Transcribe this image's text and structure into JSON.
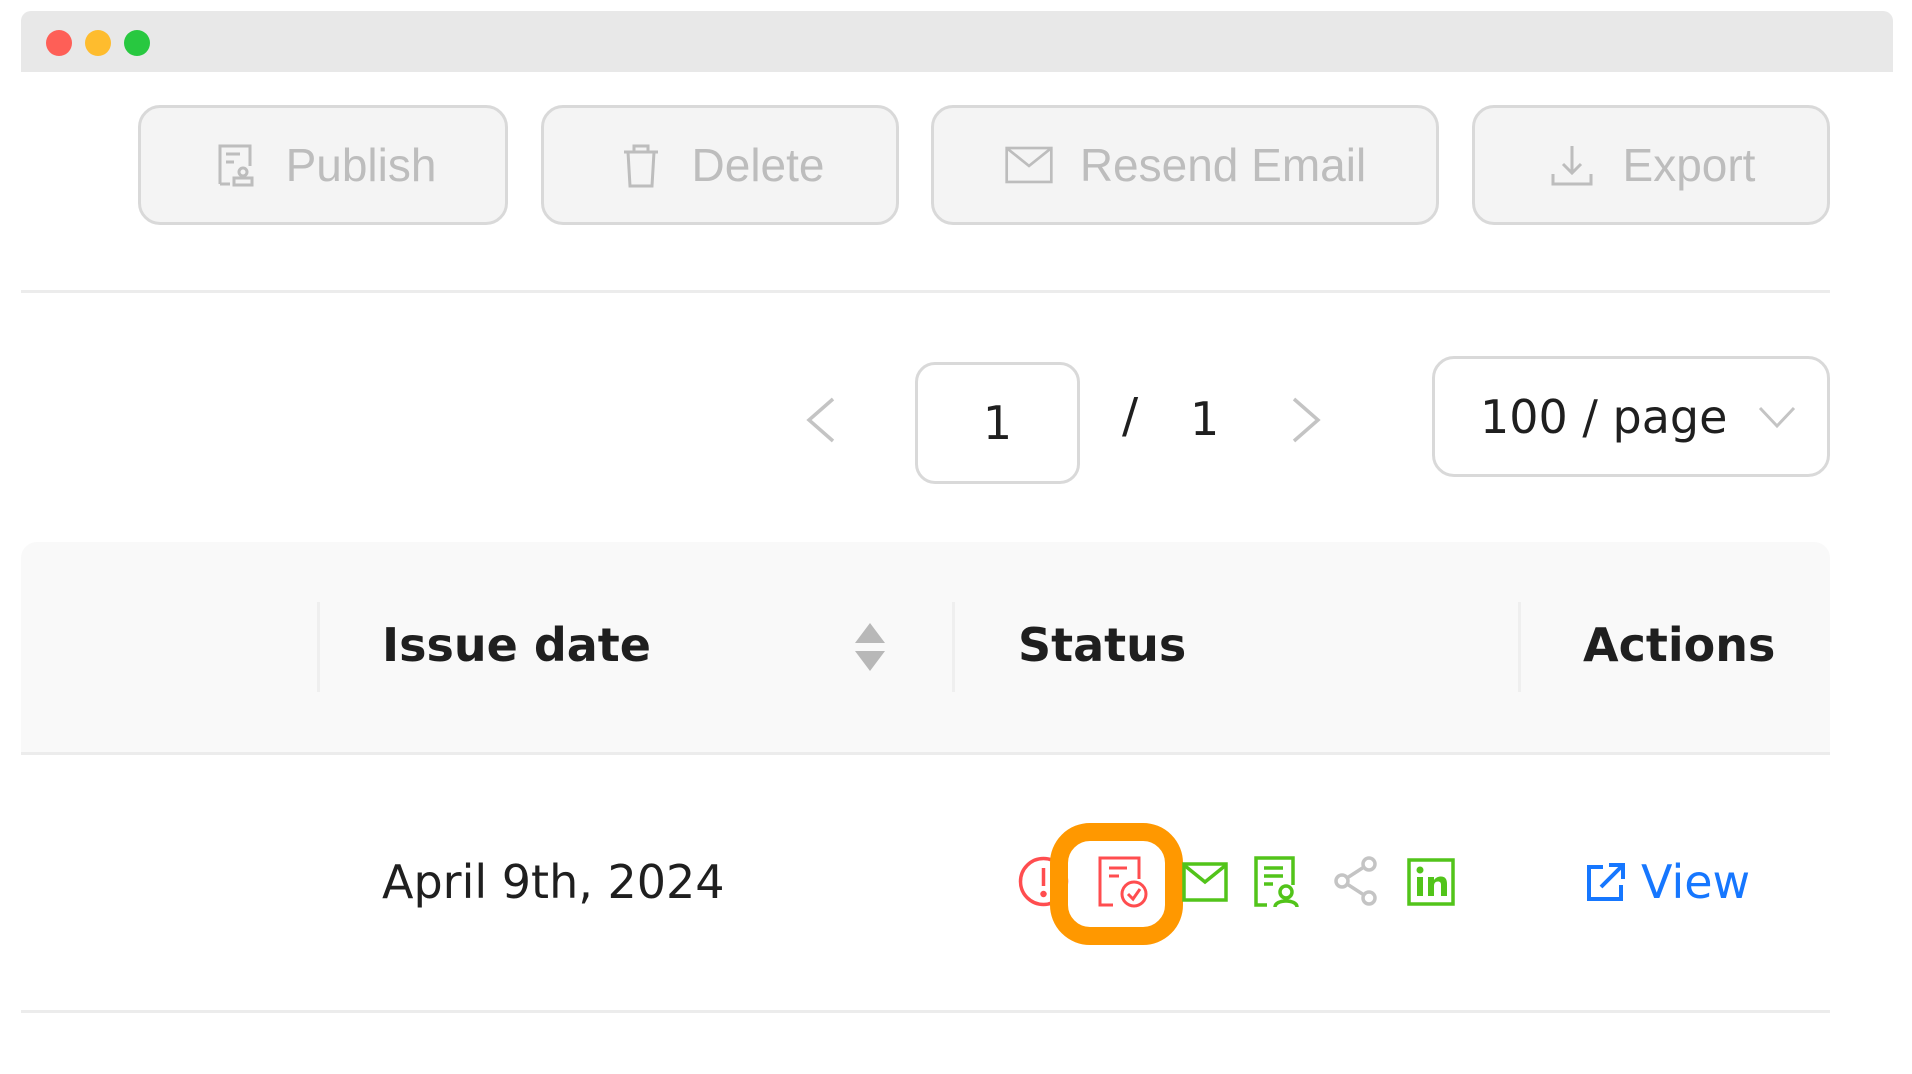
{
  "window": {
    "controls": [
      "close",
      "minimize",
      "maximize"
    ]
  },
  "toolbar": {
    "buttons": [
      {
        "id": "publish",
        "label": "Publish",
        "icon": "publish-stamp-icon",
        "disabled": true
      },
      {
        "id": "delete",
        "label": "Delete",
        "icon": "trash-icon",
        "disabled": true
      },
      {
        "id": "resend",
        "label": "Resend Email",
        "icon": "envelope-icon",
        "disabled": true
      },
      {
        "id": "export",
        "label": "Export",
        "icon": "download-icon",
        "disabled": true
      }
    ]
  },
  "pagination": {
    "current_page": "1",
    "separator": "/",
    "total_pages": "1",
    "page_size": "100 / page"
  },
  "table": {
    "columns": [
      {
        "label": "Issue date",
        "sortable": true
      },
      {
        "label": "Status",
        "sortable": false
      },
      {
        "label": "Actions",
        "sortable": false
      }
    ],
    "rows": [
      {
        "issue_date": "April 9th, 2024",
        "status_icons": [
          {
            "name": "warning-circle-icon",
            "color": "#ff4d4f"
          },
          {
            "name": "document-check-icon",
            "color": "#ff4d4f",
            "highlighted": true
          },
          {
            "name": "email-sent-icon",
            "color": "#52c41a"
          },
          {
            "name": "certificate-icon",
            "color": "#52c41a"
          },
          {
            "name": "share-icon",
            "color": "#bfbfbf"
          },
          {
            "name": "linkedin-icon",
            "color": "#52c41a"
          }
        ],
        "action_label": "View"
      }
    ]
  },
  "colors": {
    "link": "#1677ff",
    "error": "#ff4d4f",
    "success": "#52c41a",
    "muted": "#bfbfbf",
    "highlight": "#ff9800"
  }
}
